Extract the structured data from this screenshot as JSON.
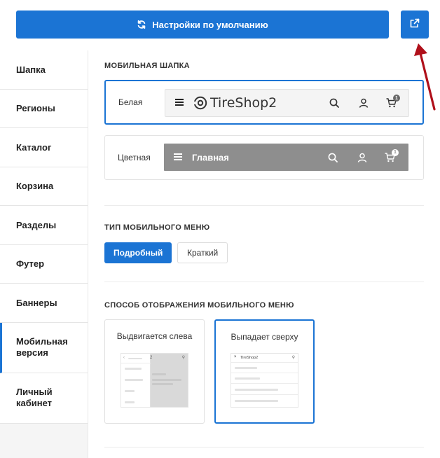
{
  "toolbar": {
    "reset_label": "Настройки по умолчанию"
  },
  "sidebar": {
    "items": [
      {
        "label": "Шапка"
      },
      {
        "label": "Регионы"
      },
      {
        "label": "Каталог"
      },
      {
        "label": "Корзина"
      },
      {
        "label": "Разделы"
      },
      {
        "label": "Футер"
      },
      {
        "label": "Баннеры"
      },
      {
        "label": "Мобильная версия"
      },
      {
        "label": "Личный кабинет"
      }
    ],
    "active": "Мобильная версия"
  },
  "mobile_header": {
    "title": "МОБИЛЬНАЯ ШАПКА",
    "options": [
      {
        "label": "Белая",
        "logo_text": "TireShop2",
        "cart_count": "1",
        "selected": true
      },
      {
        "label": "Цветная",
        "page_title": "Главная",
        "cart_count": "1",
        "selected": false
      }
    ]
  },
  "mobile_menu_type": {
    "title": "ТИП МОБИЛЬНОГО МЕНЮ",
    "options": [
      "Подробный",
      "Краткий"
    ],
    "selected": "Подробный"
  },
  "mobile_menu_display": {
    "title": "СПОСОБ ОТОБРАЖЕНИЯ МОБИЛЬНОГО МЕНЮ",
    "options": [
      {
        "label": "Выдвигается слева",
        "mini_logo": "2",
        "selected": false
      },
      {
        "label": "Выпадает сверху",
        "mini_logo": "TireShop2",
        "selected": true
      }
    ]
  },
  "colors": {
    "accent": "#1b74d4",
    "annotation_arrow": "#b0101a",
    "colored_header": "#8e8e8e"
  }
}
